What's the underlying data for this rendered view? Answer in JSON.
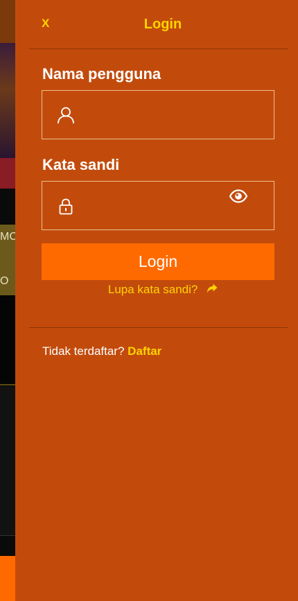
{
  "background": {
    "peek_text_1": "MC",
    "peek_text_2": "O"
  },
  "header": {
    "close_label": "X",
    "title": "Login"
  },
  "form": {
    "username": {
      "label": "Nama pengguna",
      "value": "",
      "icon": "user-icon"
    },
    "password": {
      "label": "Kata sandi",
      "value": "",
      "icon": "lock-icon",
      "toggle_icon": "eye-icon"
    },
    "submit_label": "Login",
    "forgot_label": "Lupa kata sandi?",
    "forgot_icon": "share-arrow-icon"
  },
  "footer": {
    "prompt": "Tidak terdaftar?",
    "register_label": "Daftar"
  },
  "colors": {
    "panel": "#c24b0c",
    "accent": "#ffd400",
    "button": "#ff6a00"
  }
}
